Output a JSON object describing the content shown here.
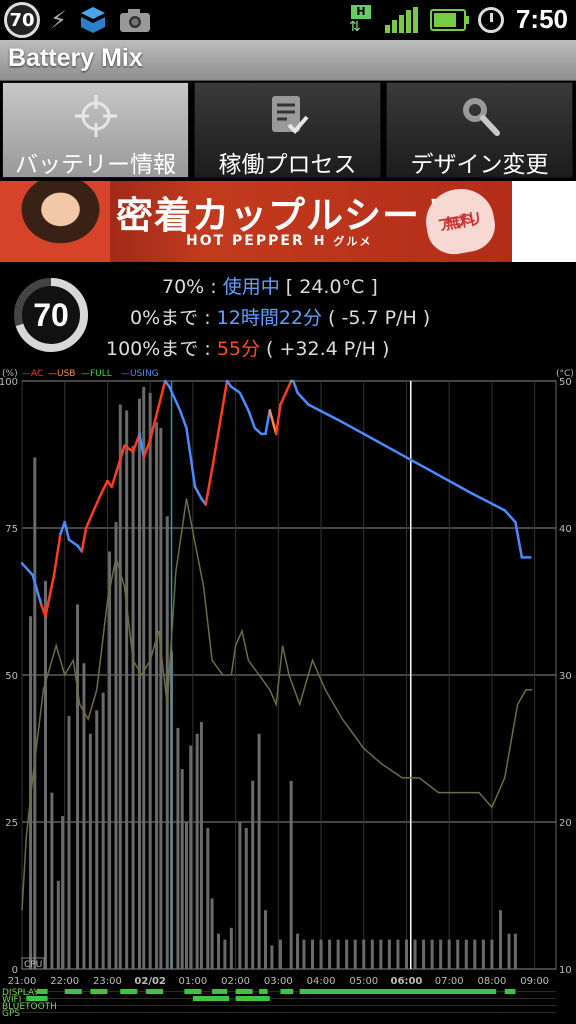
{
  "status_bar": {
    "badge": "70",
    "time": "7:50",
    "network": "H",
    "icons": [
      "battery-mix-badge",
      "usb-icon",
      "dropbox-icon",
      "camera-icon",
      "hsdpa-icon",
      "signal-icon",
      "battery-icon",
      "alarm-icon"
    ]
  },
  "app": {
    "title": "Battery Mix"
  },
  "tabs": [
    {
      "label": "バッテリー情報",
      "icon": "crosshair-icon",
      "selected": true
    },
    {
      "label": "稼働プロセス",
      "icon": "checklist-icon",
      "selected": false
    },
    {
      "label": "デザイン変更",
      "icon": "magnifier-wrench-icon",
      "selected": false
    }
  ],
  "ad": {
    "headline": "密着カップルシート",
    "brand": "HOT PEPPER",
    "brand_sub": "グルメ",
    "badge_line1": "無料",
    "badge_line2": "アプリ"
  },
  "battery": {
    "gauge_value": "70",
    "percent": "70%",
    "sep1": " : ",
    "status": "使用中",
    "temperature": "[ 24.0°C ]",
    "empty_label": "0%まで",
    "sep2": " : ",
    "empty_time": "12時間22分",
    "empty_rate": "( -5.7 P/H )",
    "full_label": "100%まで",
    "sep3": " : ",
    "full_time": "55分",
    "full_rate": "( +32.4 P/H )"
  },
  "chart_data": {
    "type": "line",
    "left_unit": "(%)",
    "right_unit": "(°C)",
    "legend": [
      {
        "name": "AC",
        "color": "#ff3b1e"
      },
      {
        "name": "USB",
        "color": "#ff8c3a"
      },
      {
        "name": "FULL",
        "color": "#39d34a"
      },
      {
        "name": "USING",
        "color": "#4a8cff"
      }
    ],
    "y_ticks": [
      "100",
      "75",
      "50",
      "25",
      "0"
    ],
    "y_right_ticks": [
      "50",
      "40",
      "30",
      "20",
      "10"
    ],
    "x_ticks": [
      "21:00",
      "22:00",
      "23:00",
      "02/02",
      "01:00",
      "02:00",
      "03:00",
      "04:00",
      "05:00",
      "06:00",
      "07:00",
      "08:00",
      "09:00"
    ],
    "x_range_hours": [
      0,
      12.5
    ],
    "cpu_label": "CPU",
    "battery_series": [
      {
        "t": 0.0,
        "v": 69,
        "m": "using"
      },
      {
        "t": 0.25,
        "v": 67,
        "m": "using"
      },
      {
        "t": 0.45,
        "v": 62,
        "m": "using"
      },
      {
        "t": 0.55,
        "v": 60,
        "m": "ac"
      },
      {
        "t": 0.75,
        "v": 67,
        "m": "ac"
      },
      {
        "t": 0.9,
        "v": 74,
        "m": "ac"
      },
      {
        "t": 1.0,
        "v": 76,
        "m": "using"
      },
      {
        "t": 1.1,
        "v": 73,
        "m": "using"
      },
      {
        "t": 1.3,
        "v": 72,
        "m": "using"
      },
      {
        "t": 1.4,
        "v": 71,
        "m": "using"
      },
      {
        "t": 1.5,
        "v": 75,
        "m": "ac"
      },
      {
        "t": 1.8,
        "v": 80,
        "m": "ac"
      },
      {
        "t": 2.0,
        "v": 83,
        "m": "ac"
      },
      {
        "t": 2.1,
        "v": 82,
        "m": "ac"
      },
      {
        "t": 2.4,
        "v": 89,
        "m": "ac"
      },
      {
        "t": 2.6,
        "v": 88,
        "m": "ac"
      },
      {
        "t": 2.75,
        "v": 91,
        "m": "ac"
      },
      {
        "t": 2.85,
        "v": 87,
        "m": "using"
      },
      {
        "t": 3.0,
        "v": 90,
        "m": "ac"
      },
      {
        "t": 3.35,
        "v": 100,
        "m": "ac"
      },
      {
        "t": 3.45,
        "v": 99,
        "m": "using"
      },
      {
        "t": 3.7,
        "v": 95,
        "m": "using"
      },
      {
        "t": 3.85,
        "v": 92,
        "m": "using"
      },
      {
        "t": 4.05,
        "v": 82,
        "m": "using"
      },
      {
        "t": 4.2,
        "v": 80,
        "m": "using"
      },
      {
        "t": 4.3,
        "v": 79,
        "m": "using"
      },
      {
        "t": 4.45,
        "v": 85,
        "m": "ac"
      },
      {
        "t": 4.8,
        "v": 100,
        "m": "ac"
      },
      {
        "t": 4.9,
        "v": 99,
        "m": "using"
      },
      {
        "t": 5.1,
        "v": 98,
        "m": "using"
      },
      {
        "t": 5.3,
        "v": 95,
        "m": "using"
      },
      {
        "t": 5.45,
        "v": 92,
        "m": "using"
      },
      {
        "t": 5.6,
        "v": 91,
        "m": "using"
      },
      {
        "t": 5.7,
        "v": 91,
        "m": "using"
      },
      {
        "t": 5.8,
        "v": 95,
        "m": "using"
      },
      {
        "t": 5.95,
        "v": 91,
        "m": "usb"
      },
      {
        "t": 6.05,
        "v": 96,
        "m": "ac"
      },
      {
        "t": 6.3,
        "v": 100,
        "m": "ac"
      },
      {
        "t": 6.35,
        "v": 100,
        "m": "full"
      },
      {
        "t": 6.45,
        "v": 98,
        "m": "using"
      },
      {
        "t": 6.7,
        "v": 96,
        "m": "using"
      },
      {
        "t": 7.5,
        "v": 93,
        "m": "using"
      },
      {
        "t": 8.5,
        "v": 89,
        "m": "using"
      },
      {
        "t": 9.5,
        "v": 85,
        "m": "using"
      },
      {
        "t": 10.5,
        "v": 81,
        "m": "using"
      },
      {
        "t": 11.3,
        "v": 78,
        "m": "using"
      },
      {
        "t": 11.55,
        "v": 76,
        "m": "using"
      },
      {
        "t": 11.7,
        "v": 70,
        "m": "using"
      },
      {
        "t": 11.9,
        "v": 70,
        "m": "using"
      }
    ],
    "temperature_series": [
      {
        "t": 0.0,
        "c": 14
      },
      {
        "t": 0.1,
        "c": 19
      },
      {
        "t": 0.25,
        "c": 23
      },
      {
        "t": 0.5,
        "c": 29
      },
      {
        "t": 0.8,
        "c": 32
      },
      {
        "t": 1.0,
        "c": 30
      },
      {
        "t": 1.2,
        "c": 31
      },
      {
        "t": 1.35,
        "c": 28
      },
      {
        "t": 1.55,
        "c": 27
      },
      {
        "t": 1.75,
        "c": 29
      },
      {
        "t": 2.0,
        "c": 35
      },
      {
        "t": 2.2,
        "c": 38
      },
      {
        "t": 2.4,
        "c": 36
      },
      {
        "t": 2.6,
        "c": 31
      },
      {
        "t": 2.8,
        "c": 30
      },
      {
        "t": 3.0,
        "c": 31
      },
      {
        "t": 3.2,
        "c": 33
      },
      {
        "t": 3.4,
        "c": 28
      },
      {
        "t": 3.6,
        "c": 37
      },
      {
        "t": 3.85,
        "c": 42
      },
      {
        "t": 4.05,
        "c": 39
      },
      {
        "t": 4.25,
        "c": 36
      },
      {
        "t": 4.45,
        "c": 31
      },
      {
        "t": 4.7,
        "c": 30
      },
      {
        "t": 4.9,
        "c": 30
      },
      {
        "t": 5.0,
        "c": 32
      },
      {
        "t": 5.15,
        "c": 33
      },
      {
        "t": 5.3,
        "c": 31
      },
      {
        "t": 5.55,
        "c": 30
      },
      {
        "t": 5.8,
        "c": 29
      },
      {
        "t": 5.95,
        "c": 28
      },
      {
        "t": 6.1,
        "c": 32
      },
      {
        "t": 6.25,
        "c": 30
      },
      {
        "t": 6.5,
        "c": 28
      },
      {
        "t": 6.8,
        "c": 31
      },
      {
        "t": 7.1,
        "c": 29
      },
      {
        "t": 7.5,
        "c": 27
      },
      {
        "t": 8.0,
        "c": 25
      },
      {
        "t": 8.4,
        "c": 24
      },
      {
        "t": 8.9,
        "c": 23
      },
      {
        "t": 9.3,
        "c": 23
      },
      {
        "t": 9.75,
        "c": 22
      },
      {
        "t": 10.2,
        "c": 22
      },
      {
        "t": 10.7,
        "c": 22
      },
      {
        "t": 11.0,
        "c": 21
      },
      {
        "t": 11.3,
        "c": 23
      },
      {
        "t": 11.6,
        "c": 28
      },
      {
        "t": 11.8,
        "c": 29
      },
      {
        "t": 11.95,
        "c": 29
      }
    ],
    "cpu_bars": [
      {
        "t": 0.2,
        "v": 60
      },
      {
        "t": 0.3,
        "v": 87
      },
      {
        "t": 0.55,
        "v": 66
      },
      {
        "t": 0.7,
        "v": 30
      },
      {
        "t": 0.85,
        "v": 15
      },
      {
        "t": 0.95,
        "v": 26
      },
      {
        "t": 1.1,
        "v": 43
      },
      {
        "t": 1.3,
        "v": 62
      },
      {
        "t": 1.45,
        "v": 52
      },
      {
        "t": 1.6,
        "v": 40
      },
      {
        "t": 1.75,
        "v": 44
      },
      {
        "t": 1.9,
        "v": 47
      },
      {
        "t": 2.05,
        "v": 71
      },
      {
        "t": 2.2,
        "v": 76
      },
      {
        "t": 2.3,
        "v": 96
      },
      {
        "t": 2.45,
        "v": 95
      },
      {
        "t": 2.6,
        "v": 89
      },
      {
        "t": 2.75,
        "v": 97
      },
      {
        "t": 2.85,
        "v": 99
      },
      {
        "t": 3.0,
        "v": 98
      },
      {
        "t": 3.15,
        "v": 93
      },
      {
        "t": 3.25,
        "v": 92
      },
      {
        "t": 3.4,
        "v": 77
      },
      {
        "t": 3.5,
        "v": 54
      },
      {
        "t": 3.65,
        "v": 41
      },
      {
        "t": 3.75,
        "v": 34
      },
      {
        "t": 3.85,
        "v": 25
      },
      {
        "t": 3.95,
        "v": 38
      },
      {
        "t": 4.1,
        "v": 40
      },
      {
        "t": 4.2,
        "v": 42
      },
      {
        "t": 4.35,
        "v": 24
      },
      {
        "t": 4.45,
        "v": 12
      },
      {
        "t": 4.6,
        "v": 6
      },
      {
        "t": 4.75,
        "v": 5
      },
      {
        "t": 4.9,
        "v": 7
      },
      {
        "t": 5.1,
        "v": 25
      },
      {
        "t": 5.25,
        "v": 24
      },
      {
        "t": 5.4,
        "v": 32
      },
      {
        "t": 5.55,
        "v": 40
      },
      {
        "t": 5.7,
        "v": 10
      },
      {
        "t": 5.85,
        "v": 4
      },
      {
        "t": 6.05,
        "v": 5
      },
      {
        "t": 6.3,
        "v": 32
      },
      {
        "t": 6.45,
        "v": 6
      },
      {
        "t": 6.6,
        "v": 5
      },
      {
        "t": 6.8,
        "v": 5
      },
      {
        "t": 7.0,
        "v": 5
      },
      {
        "t": 7.2,
        "v": 5
      },
      {
        "t": 7.4,
        "v": 5
      },
      {
        "t": 7.6,
        "v": 5
      },
      {
        "t": 7.8,
        "v": 5
      },
      {
        "t": 8.0,
        "v": 5
      },
      {
        "t": 8.2,
        "v": 5
      },
      {
        "t": 8.4,
        "v": 5
      },
      {
        "t": 8.6,
        "v": 5
      },
      {
        "t": 8.8,
        "v": 5
      },
      {
        "t": 9.0,
        "v": 5
      },
      {
        "t": 9.2,
        "v": 5
      },
      {
        "t": 9.4,
        "v": 5
      },
      {
        "t": 9.6,
        "v": 5
      },
      {
        "t": 9.8,
        "v": 5
      },
      {
        "t": 10.0,
        "v": 5
      },
      {
        "t": 10.2,
        "v": 5
      },
      {
        "t": 10.4,
        "v": 5
      },
      {
        "t": 10.6,
        "v": 5
      },
      {
        "t": 10.8,
        "v": 5
      },
      {
        "t": 11.0,
        "v": 5
      },
      {
        "t": 11.2,
        "v": 10
      },
      {
        "t": 11.4,
        "v": 6
      },
      {
        "t": 11.55,
        "v": 6
      }
    ],
    "markers": [
      {
        "t": 3.5,
        "color": "#1f9fb5"
      },
      {
        "t": 9.1,
        "color": "#ffffff"
      }
    ],
    "status_rows": [
      {
        "name": "DISPLAY",
        "segments": [
          [
            0.35,
            0.6
          ],
          [
            1.0,
            1.4
          ],
          [
            1.6,
            2.0
          ],
          [
            2.3,
            2.7
          ],
          [
            2.9,
            3.3
          ],
          [
            3.8,
            4.2
          ],
          [
            4.45,
            4.8
          ],
          [
            5.0,
            5.4
          ],
          [
            5.55,
            5.75
          ],
          [
            6.05,
            6.35
          ],
          [
            6.5,
            11.1
          ],
          [
            11.3,
            11.55
          ]
        ]
      },
      {
        "name": "WIFI",
        "segments": [
          [
            0.1,
            0.6
          ],
          [
            4.0,
            4.85
          ],
          [
            5.0,
            5.8
          ]
        ]
      },
      {
        "name": "BLUETOOTH",
        "segments": []
      },
      {
        "name": "GPS",
        "segments": []
      }
    ]
  }
}
